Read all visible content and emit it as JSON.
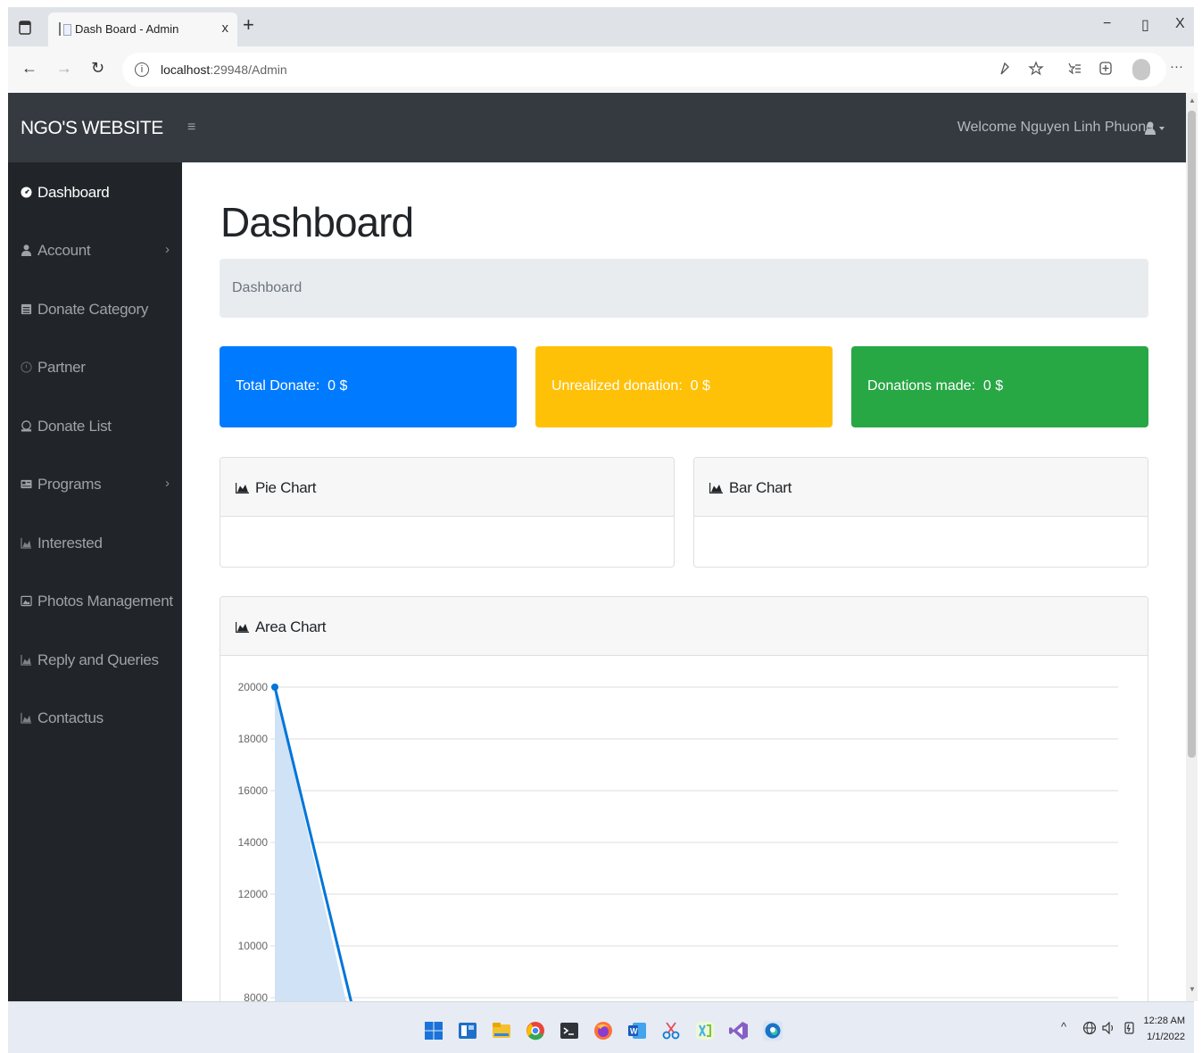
{
  "browser": {
    "tab_title": "Dash Board - Admin",
    "tab_close": "x",
    "new_tab": "+",
    "url_host": "localhost",
    "url_rest": ":29948/Admin",
    "minimize": "−",
    "restore": "▯",
    "close": "X",
    "more": "···"
  },
  "navbar": {
    "brand": "NGO'S WEBSITE",
    "toggle": "≡",
    "welcome": "Welcome Nguyen Linh Phuong"
  },
  "sidebar": {
    "items": [
      {
        "label": "Dashboard",
        "icon": "dashboard-icon"
      },
      {
        "label": "Account",
        "icon": "user-icon",
        "chevron": "›"
      },
      {
        "label": "Donate Category",
        "icon": "list-icon"
      },
      {
        "label": "Partner",
        "icon": "circle-icon"
      },
      {
        "label": "Donate List",
        "icon": "donate-icon"
      },
      {
        "label": "Programs",
        "icon": "programs-icon",
        "chevron": "›"
      },
      {
        "label": "Interested",
        "icon": "area-chart-icon"
      },
      {
        "label": "Photos Management",
        "icon": "image-icon"
      },
      {
        "label": "Reply and Queries",
        "icon": "area-chart-icon"
      },
      {
        "label": "Contactus",
        "icon": "area-chart-icon"
      }
    ]
  },
  "main": {
    "title": "Dashboard",
    "breadcrumb": "Dashboard",
    "stats": [
      {
        "label": "Total Donate:  0 $",
        "color": "#007bff"
      },
      {
        "label": "Unrealized donation:  0 $",
        "color": "#ffc107"
      },
      {
        "label": "Donations made:  0 $",
        "color": "#28a745"
      }
    ],
    "pie_title": "Pie Chart",
    "bar_title": "Bar Chart",
    "area_title": "Area Chart"
  },
  "chart_data": {
    "type": "area",
    "title": "Area Chart",
    "y_ticks": [
      20000,
      18000,
      16000,
      14000,
      12000,
      10000,
      8000
    ],
    "ylim": [
      8000,
      20000
    ],
    "series": [
      {
        "values": [
          20000,
          8000
        ],
        "color": "#0275d8",
        "fill": "#cfe2f6"
      }
    ],
    "grid": true
  },
  "taskbar": {
    "time": "12:28 AM",
    "date": "1/1/2022",
    "apps": [
      "start-icon",
      "widgets-icon",
      "file-explorer-icon",
      "chrome-icon",
      "terminal-icon",
      "firefox-icon",
      "word-icon",
      "snipping-icon",
      "xd-icon",
      "visual-studio-icon",
      "edge-icon"
    ]
  }
}
